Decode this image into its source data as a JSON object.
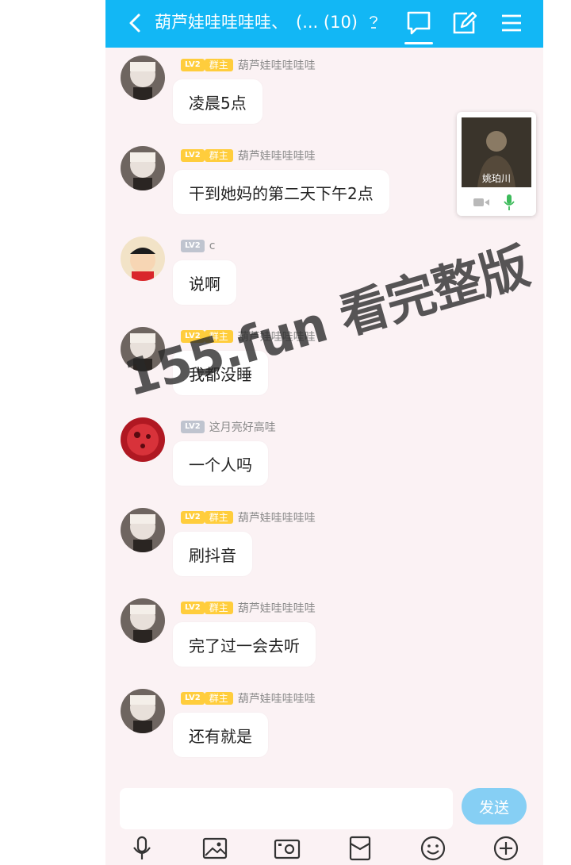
{
  "header": {
    "title": "葫芦娃哇哇哇哇、",
    "count": "(... (10)"
  },
  "call": {
    "name": "姚珀川"
  },
  "watermark": "155.fun 看完整版",
  "messages": [
    {
      "level": "LV2",
      "role": "群主",
      "username": "葫芦娃哇哇哇哇",
      "text": "凌晨5点"
    },
    {
      "level": "LV2",
      "role": "群主",
      "username": "葫芦娃哇哇哇哇",
      "text": "干到她妈的第二天下午2点"
    },
    {
      "level": "LV2",
      "role": "",
      "username": "c",
      "text": "说啊"
    },
    {
      "level": "LV2",
      "role": "群主",
      "username": "葫芦娃哇哇哇哇",
      "text": "我都没睡"
    },
    {
      "level": "LV2",
      "role": "",
      "username": "这月亮好高哇",
      "text": "一个人吗"
    },
    {
      "level": "LV2",
      "role": "群主",
      "username": "葫芦娃哇哇哇哇",
      "text": "刷抖音"
    },
    {
      "level": "LV2",
      "role": "群主",
      "username": "葫芦娃哇哇哇哇",
      "text": "完了过一会去听"
    },
    {
      "level": "LV2",
      "role": "群主",
      "username": "葫芦娃哇哇哇哇",
      "text": "还有就是"
    }
  ],
  "input": {
    "value": "",
    "placeholder": ""
  },
  "send_label": "发送",
  "colors": {
    "header": "#12b7f5",
    "send": "#86cff4",
    "owner_badge": "#ffcd3c",
    "level_badge_plain": "#bfc4cf"
  },
  "toolbar_icons": [
    "mic-icon",
    "image-icon",
    "camera-icon",
    "red-packet-icon",
    "emoji-icon",
    "plus-icon"
  ]
}
